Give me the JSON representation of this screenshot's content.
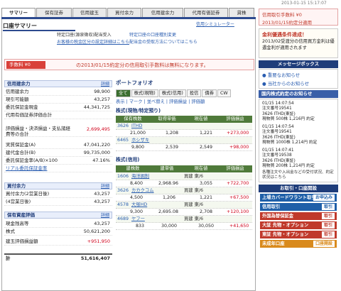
{
  "timestamp": "2013-01-15 15:17:07",
  "tabs": [
    "サマリー",
    "保有証券",
    "信用建玉",
    "買付余力",
    "信用建余力",
    "代用有価証券",
    "貸株"
  ],
  "header": {
    "title": "口座サマリー",
    "simulator": "信用シミュレーター"
  },
  "info": {
    "line1": "特定口座(源泉徴収)配当受入",
    "line1r": "特定口座の口座種別変更",
    "line2": "お客様の税金区分の設定詳細はこちら",
    "line2r": "配当金の受取方法についてはこちら"
  },
  "promo": {
    "badge": "手数料 ¥0",
    "text": "の2013/01/15約定分の信用取引手数料は無料になります。"
  },
  "shinyo": {
    "title": "信用建余力",
    "detail": "詳細",
    "rows": [
      {
        "k": "信用建余力",
        "v": "98,900"
      },
      {
        "k": "現引可能額",
        "v": "43,257"
      },
      {
        "k": "委託保証金現金",
        "v": "44,341,725"
      },
      {
        "k": "代用有価証券評価合計",
        "v": ""
      },
      {
        "k": "評価損益・決済損益・支払諸経費等の合計",
        "v": "2,699,495"
      },
      {
        "k": "実質保証金(A)",
        "v": "47,041,220"
      },
      {
        "k": "建代金合計(B)",
        "v": "99,735,000"
      },
      {
        "k": "委託保証金率(A/B)×100",
        "v": "47.16%"
      },
      {
        "k": "リアル委託保証金率",
        "v": ""
      }
    ]
  },
  "kaitsuke": {
    "title": "買付余力",
    "detail": "詳細",
    "rows": [
      {
        "k": "買付余力(2営業日後)",
        "v": "43,257"
      },
      {
        "k": "(4営業日後)",
        "v": "43,257"
      }
    ]
  },
  "hoyu": {
    "title": "保有資産評価",
    "detail": "詳細",
    "rows": [
      {
        "k": "現金残高等",
        "v": "43,257"
      },
      {
        "k": "株式",
        "v": "50,621,200"
      },
      {
        "k": "建玉評価損益額",
        "v": "+951,950"
      }
    ],
    "total_k": "計",
    "total_v": "51,616,407"
  },
  "pf": {
    "title": "ポートフォリオ",
    "tabs": [
      "全て",
      "株式(現物)",
      "株式(信用)",
      "投信",
      "債券",
      "CW"
    ],
    "bar": "表示 | マーク | 並べ替え | 評価損益 | 評価額",
    "sec1": "株式(現物/特定預り)",
    "head1": [
      "保有株数",
      "取得単価",
      "現在値",
      "評価損益"
    ],
    "r1": [
      {
        "code": "3626",
        "name": "ITHD",
        "qty": "21,000",
        "cost": "1,208",
        "now": "1,221",
        "pl": "+273,000"
      },
      {
        "code": "6465",
        "name": "ホシザキ",
        "qty": "9,800",
        "cost": "2,539",
        "now": "2,549",
        "pl": "+98,000"
      }
    ],
    "sec2": "株式(信用)",
    "head2": [
      "建株数",
      "建単価",
      "現在値",
      "評価損益"
    ],
    "r2": [
      {
        "code": "1606",
        "name": "海洋掘削",
        "qty": "8,400",
        "cost": "2,968.96",
        "now": "3,055",
        "pl": "+722,700",
        "k": "買建 東/6"
      },
      {
        "code": "3626",
        "name": "カカクコム",
        "qty": "4,500",
        "cost": "1,206",
        "now": "1,221",
        "pl": "+67,500",
        "k": "買建 東/6"
      },
      {
        "code": "4578",
        "name": "大塚HD",
        "qty": "9,300",
        "cost": "2,695.08",
        "now": "2,708",
        "pl": "+120,100",
        "k": "買建 東/6"
      },
      {
        "code": "4689",
        "name": "ヤフー",
        "qty": "833",
        "cost": "30,000",
        "now": "30,050",
        "pl": "+41,650",
        "k": "買建 東/6"
      }
    ]
  },
  "side": {
    "fee_label": "信用取引手数料 ¥0",
    "fee_date": "2013/01/15約定分適用",
    "news_title": "金利優遇条件達成！",
    "news_body": "2013/02受渡分の信用買方金利は優遇金利が適用されます",
    "msgbox": "メッセージボックス",
    "msg1": "重要なお知らせ",
    "msg2": "当社からのお知らせ",
    "exec_title": "国内株式約定のお知らせ",
    "exec": [
      {
        "d": "01/15 14:07:54",
        "n": "注文番号19541",
        "t": "3626 ITHD(東証)",
        "s": "現物買 500株 1,216円 約定"
      },
      {
        "d": "01/15 14:07:54",
        "n": "注文番号19541",
        "t": "3626 ITHD(東証)",
        "s": "現物買 1000株 1,214円 約定"
      },
      {
        "d": "01/15 14:07:41",
        "n": "注文番号19538",
        "t": "3626 ITHD(東証)",
        "s": "現物買 200株 1,214円 約定"
      }
    ],
    "note": "各種注文や入出金などの受付状況、約定状況はこちら",
    "acct_title": "お取引・口座開設",
    "btns": [
      {
        "l": "上場カバードワラント取引",
        "r": "お申込み",
        "c": "#1f5fa8"
      },
      {
        "l": "信用取引",
        "r": "取引",
        "c": "#1f5fa8"
      },
      {
        "l": "外国為替保証金",
        "r": "取引",
        "c": "#c0392b"
      },
      {
        "l": "大証 先物・オプション",
        "r": "取引",
        "c": "#c0392b"
      },
      {
        "l": "東証 先物・オプション",
        "r": "取引",
        "c": "#c0392b"
      },
      {
        "l": "未成年口座",
        "r": "口座開設",
        "c": "#d98a1c"
      }
    ]
  }
}
